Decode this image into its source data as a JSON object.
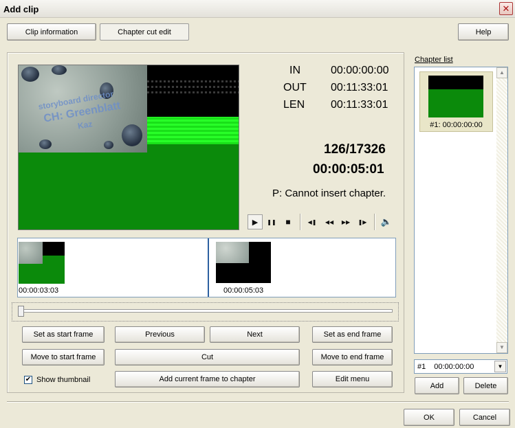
{
  "window": {
    "title": "Add clip",
    "close_glyph": "✕"
  },
  "tabs": {
    "clip_info": "Clip information",
    "chapter_cut_edit": "Chapter cut edit"
  },
  "toolbar": {
    "help": "Help"
  },
  "preview": {
    "in_label": "IN",
    "in_value": "00:00:00:00",
    "out_label": "OUT",
    "out_value": "00:11:33:01",
    "len_label": "LEN",
    "len_value": "00:11:33:01",
    "frame_counter": "126/17326",
    "current_time": "00:00:05:01",
    "status": "P: Cannot insert chapter.",
    "overlay_line1": "storyboard director",
    "overlay_line2": "CH: Greenblatt",
    "overlay_line3": "Kaz"
  },
  "playback": {
    "play": "▶",
    "pause": "❚❚",
    "stop": "■",
    "prev_frame": "◀❚",
    "rewind": "◀◀",
    "fast_forward": "▶▶",
    "next_frame": "❚▶",
    "volume": "🔈"
  },
  "thumbnails": [
    {
      "time": "00:00:03:03"
    },
    {
      "time": "00:00:05:03"
    }
  ],
  "buttons": {
    "set_start": "Set as start frame",
    "previous": "Previous",
    "next": "Next",
    "set_end": "Set as end frame",
    "move_start": "Move to start frame",
    "cut": "Cut",
    "move_end": "Move to end frame",
    "add_chapter": "Add current frame to chapter",
    "edit_menu": "Edit menu"
  },
  "show_thumbnail": {
    "label": "Show thumbnail",
    "checked_glyph": "✔"
  },
  "chapter_list": {
    "title": "Chapter list",
    "items": [
      {
        "label": "#1: 00:00:00:00"
      }
    ],
    "selected_no": "#1",
    "selected_time": "00:00:00:00",
    "add": "Add",
    "delete": "Delete"
  },
  "footer": {
    "ok": "OK",
    "cancel": "Cancel"
  }
}
